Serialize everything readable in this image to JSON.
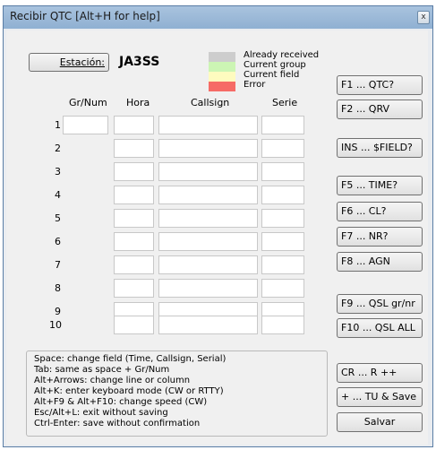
{
  "window": {
    "title": "Recibir QTC [Alt+H for help]",
    "close_glyph": "x"
  },
  "station": {
    "button_label": "Estación:",
    "callsign": "JA3SS"
  },
  "legend": [
    {
      "label": "Already received",
      "color": "#cdcdcd"
    },
    {
      "label": "Current group",
      "color": "#ccf5b4"
    },
    {
      "label": "Current field",
      "color": "#fefbbf"
    },
    {
      "label": "Error",
      "color": "#f66b66"
    }
  ],
  "columns": {
    "grnum": "Gr/Num",
    "hora": "Hora",
    "callsign": "Callsign",
    "serie": "Serie"
  },
  "rows": [
    {
      "num": "1",
      "grnum": "",
      "hora": "",
      "callsign": "",
      "serie": ""
    },
    {
      "num": "2",
      "hora": "",
      "callsign": "",
      "serie": ""
    },
    {
      "num": "3",
      "hora": "",
      "callsign": "",
      "serie": ""
    },
    {
      "num": "4",
      "hora": "",
      "callsign": "",
      "serie": ""
    },
    {
      "num": "5",
      "hora": "",
      "callsign": "",
      "serie": ""
    },
    {
      "num": "6",
      "hora": "",
      "callsign": "",
      "serie": ""
    },
    {
      "num": "7",
      "hora": "",
      "callsign": "",
      "serie": ""
    },
    {
      "num": "8",
      "hora": "",
      "callsign": "",
      "serie": ""
    },
    {
      "num": "9",
      "hora": "",
      "callsign": "",
      "serie": ""
    },
    {
      "num": "10",
      "hora": "",
      "callsign": "",
      "serie": ""
    }
  ],
  "fkeys": [
    {
      "label": "F1 ... QTC?"
    },
    {
      "label": "F2 ... QRV"
    },
    {
      "label": "INS ... $FIELD?"
    },
    {
      "label": "F5 ... TIME?"
    },
    {
      "label": "F6 ... CL?"
    },
    {
      "label": "F7 ... NR?"
    },
    {
      "label": "F8 ... AGN"
    },
    {
      "label": "F9 ... QSL gr/nr"
    },
    {
      "label": "F10 ... QSL ALL"
    },
    {
      "label": "CR ... R ++"
    },
    {
      "label": "+    ... TU & Save"
    }
  ],
  "save_button": "Salvar",
  "help_lines": [
    "Space: change field (Time, Callsign, Serial)",
    "Tab: same as space + Gr/Num",
    "Alt+Arrows: change line or column",
    "Alt+K: enter keyboard mode (CW or RTTY)",
    "Alt+F9 & Alt+F10: change speed (CW)",
    "Esc/Alt+L: exit without saving",
    "Ctrl-Enter: save without confirmation"
  ]
}
